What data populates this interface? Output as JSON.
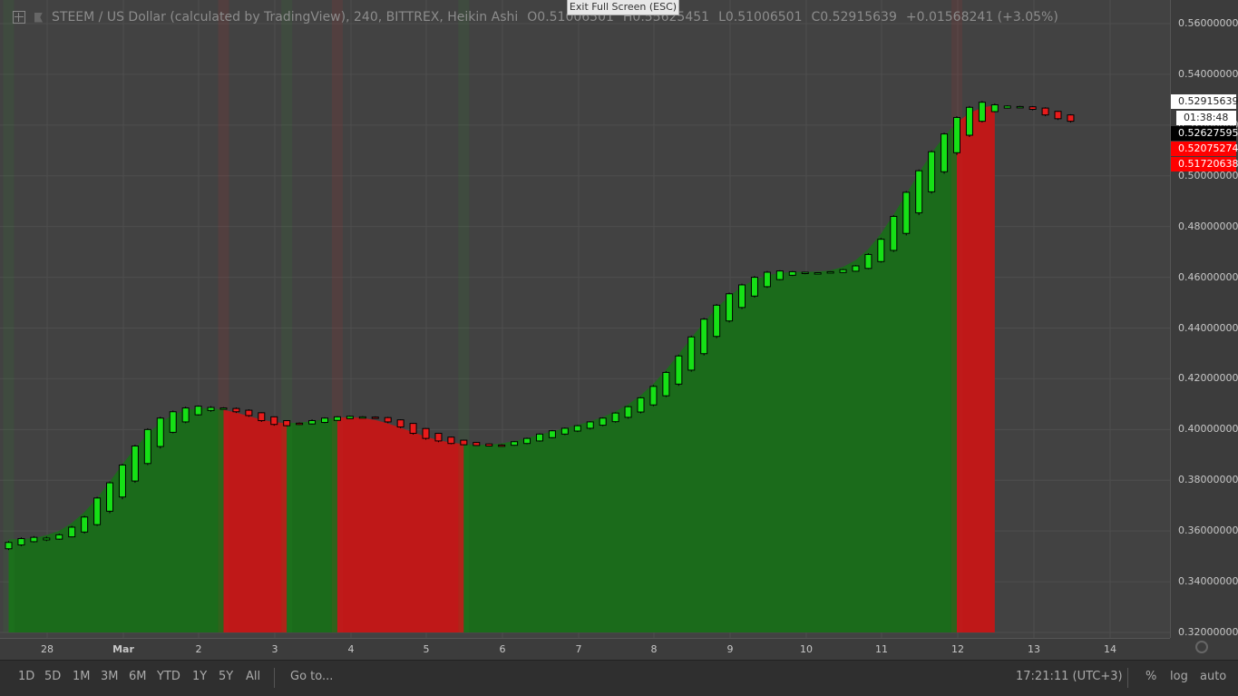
{
  "legend": {
    "title": "STEEM / US Dollar (calculated by TradingView), 240, BITTREX, Heikin Ashi",
    "open": "O0.51006501",
    "high": "H0.55625451",
    "low": "L0.51006501",
    "close": "C0.52915639",
    "change": "+0.01568241 (+3.05%)"
  },
  "exit_fullscreen": "Exit Full Screen (ESC)",
  "price_labels": {
    "last": "0.52915639",
    "countdown": "01:38:48",
    "dark": "0.52627595",
    "red1": "0.52075274",
    "red2": "0.51720638"
  },
  "colors": {
    "up": "#16e016",
    "down": "#e81b1b",
    "area_up": "#1b6b1b",
    "area_down": "#bf1818",
    "background": "#424242"
  },
  "chart_data": {
    "type": "candlestick",
    "chart_style": "Heikin Ashi",
    "interval": "240",
    "exchange": "BITTREX",
    "symbol": "STEEM / US Dollar",
    "ylim": [
      0.32,
      0.565
    ],
    "y_ticks": [
      "0.56000000",
      "0.54000000",
      "0.52000000",
      "0.50000000",
      "0.48000000",
      "0.46000000",
      "0.44000000",
      "0.42000000",
      "0.40000000",
      "0.38000000",
      "0.36000000",
      "0.34000000",
      "0.32000000"
    ],
    "x_ticks": [
      "28",
      "Mar",
      "2",
      "3",
      "4",
      "5",
      "6",
      "7",
      "8",
      "9",
      "10",
      "11",
      "12",
      "13",
      "14"
    ],
    "candles": [
      {
        "open": 0.353,
        "close": 0.3555,
        "high": 0.356,
        "low": 0.3525
      },
      {
        "open": 0.3545,
        "close": 0.357,
        "high": 0.3575,
        "low": 0.354
      },
      {
        "open": 0.3558,
        "close": 0.3575,
        "high": 0.358,
        "low": 0.3555
      },
      {
        "open": 0.3565,
        "close": 0.3572,
        "high": 0.3578,
        "low": 0.356
      },
      {
        "open": 0.3568,
        "close": 0.3585,
        "high": 0.359,
        "low": 0.3565
      },
      {
        "open": 0.3577,
        "close": 0.3615,
        "high": 0.362,
        "low": 0.3575
      },
      {
        "open": 0.3596,
        "close": 0.3655,
        "high": 0.366,
        "low": 0.359
      },
      {
        "open": 0.3625,
        "close": 0.373,
        "high": 0.3735,
        "low": 0.362
      },
      {
        "open": 0.3678,
        "close": 0.379,
        "high": 0.3795,
        "low": 0.367
      },
      {
        "open": 0.3734,
        "close": 0.386,
        "high": 0.3865,
        "low": 0.3725
      },
      {
        "open": 0.3797,
        "close": 0.3935,
        "high": 0.394,
        "low": 0.379
      },
      {
        "open": 0.3866,
        "close": 0.4,
        "high": 0.4005,
        "low": 0.386
      },
      {
        "open": 0.3933,
        "close": 0.4045,
        "high": 0.405,
        "low": 0.3925
      },
      {
        "open": 0.3989,
        "close": 0.407,
        "high": 0.4075,
        "low": 0.3985
      },
      {
        "open": 0.403,
        "close": 0.4085,
        "high": 0.409,
        "low": 0.4025
      },
      {
        "open": 0.4058,
        "close": 0.4092,
        "high": 0.4095,
        "low": 0.4055
      },
      {
        "open": 0.4075,
        "close": 0.4087,
        "high": 0.4092,
        "low": 0.407
      },
      {
        "open": 0.4081,
        "close": 0.4085,
        "high": 0.4088,
        "low": 0.4078
      },
      {
        "open": 0.4083,
        "close": 0.407,
        "high": 0.4087,
        "low": 0.4065
      },
      {
        "open": 0.4076,
        "close": 0.4055,
        "high": 0.408,
        "low": 0.405
      },
      {
        "open": 0.4066,
        "close": 0.4035,
        "high": 0.4068,
        "low": 0.403
      },
      {
        "open": 0.405,
        "close": 0.402,
        "high": 0.4052,
        "low": 0.4015
      },
      {
        "open": 0.4035,
        "close": 0.4015,
        "high": 0.4037,
        "low": 0.4012
      },
      {
        "open": 0.4025,
        "close": 0.402,
        "high": 0.4028,
        "low": 0.4018
      },
      {
        "open": 0.4022,
        "close": 0.4035,
        "high": 0.404,
        "low": 0.402
      },
      {
        "open": 0.4028,
        "close": 0.4045,
        "high": 0.4048,
        "low": 0.4025
      },
      {
        "open": 0.4036,
        "close": 0.405,
        "high": 0.4053,
        "low": 0.4034
      },
      {
        "open": 0.4043,
        "close": 0.4052,
        "high": 0.4055,
        "low": 0.4041
      },
      {
        "open": 0.4048,
        "close": 0.405,
        "high": 0.4053,
        "low": 0.4046
      },
      {
        "open": 0.4049,
        "close": 0.4045,
        "high": 0.4052,
        "low": 0.4044
      },
      {
        "open": 0.4047,
        "close": 0.403,
        "high": 0.405,
        "low": 0.4025
      },
      {
        "open": 0.4038,
        "close": 0.401,
        "high": 0.404,
        "low": 0.4005
      },
      {
        "open": 0.4024,
        "close": 0.3985,
        "high": 0.4026,
        "low": 0.398
      },
      {
        "open": 0.4004,
        "close": 0.3965,
        "high": 0.4006,
        "low": 0.396
      },
      {
        "open": 0.3985,
        "close": 0.3955,
        "high": 0.3987,
        "low": 0.395
      },
      {
        "open": 0.397,
        "close": 0.3945,
        "high": 0.3972,
        "low": 0.3942
      },
      {
        "open": 0.3958,
        "close": 0.394,
        "high": 0.396,
        "low": 0.3938
      },
      {
        "open": 0.3949,
        "close": 0.3937,
        "high": 0.3951,
        "low": 0.3935
      },
      {
        "open": 0.3943,
        "close": 0.3935,
        "high": 0.3945,
        "low": 0.3933
      },
      {
        "open": 0.3939,
        "close": 0.3937,
        "high": 0.3942,
        "low": 0.3935
      },
      {
        "open": 0.3938,
        "close": 0.3952,
        "high": 0.3955,
        "low": 0.3936
      },
      {
        "open": 0.3945,
        "close": 0.3965,
        "high": 0.3968,
        "low": 0.3942
      },
      {
        "open": 0.3955,
        "close": 0.3982,
        "high": 0.3985,
        "low": 0.3952
      },
      {
        "open": 0.3968,
        "close": 0.3995,
        "high": 0.3998,
        "low": 0.3965
      },
      {
        "open": 0.3982,
        "close": 0.4005,
        "high": 0.4008,
        "low": 0.3978
      },
      {
        "open": 0.3994,
        "close": 0.4015,
        "high": 0.4018,
        "low": 0.399
      },
      {
        "open": 0.4005,
        "close": 0.403,
        "high": 0.4033,
        "low": 0.4
      },
      {
        "open": 0.4017,
        "close": 0.4045,
        "high": 0.4048,
        "low": 0.4013
      },
      {
        "open": 0.4031,
        "close": 0.4065,
        "high": 0.4068,
        "low": 0.4027
      },
      {
        "open": 0.4048,
        "close": 0.409,
        "high": 0.4093,
        "low": 0.4043
      },
      {
        "open": 0.4069,
        "close": 0.4125,
        "high": 0.4128,
        "low": 0.4064
      },
      {
        "open": 0.4097,
        "close": 0.417,
        "high": 0.4175,
        "low": 0.4092
      },
      {
        "open": 0.4133,
        "close": 0.4225,
        "high": 0.423,
        "low": 0.4128
      },
      {
        "open": 0.4179,
        "close": 0.429,
        "high": 0.4295,
        "low": 0.4172
      },
      {
        "open": 0.4234,
        "close": 0.4365,
        "high": 0.437,
        "low": 0.4228
      },
      {
        "open": 0.4299,
        "close": 0.4435,
        "high": 0.444,
        "low": 0.4292
      },
      {
        "open": 0.4367,
        "close": 0.449,
        "high": 0.4495,
        "low": 0.436
      },
      {
        "open": 0.4428,
        "close": 0.4535,
        "high": 0.454,
        "low": 0.4422
      },
      {
        "open": 0.4481,
        "close": 0.457,
        "high": 0.4575,
        "low": 0.4475
      },
      {
        "open": 0.4526,
        "close": 0.46,
        "high": 0.4605,
        "low": 0.452
      },
      {
        "open": 0.4563,
        "close": 0.462,
        "high": 0.4625,
        "low": 0.4558
      },
      {
        "open": 0.4591,
        "close": 0.4625,
        "high": 0.4628,
        "low": 0.4588
      },
      {
        "open": 0.4608,
        "close": 0.4622,
        "high": 0.4625,
        "low": 0.4605
      },
      {
        "open": 0.4615,
        "close": 0.462,
        "high": 0.4622,
        "low": 0.4612
      },
      {
        "open": 0.4617,
        "close": 0.4618,
        "high": 0.462,
        "low": 0.4615
      },
      {
        "open": 0.4617,
        "close": 0.4622,
        "high": 0.4624,
        "low": 0.4615
      },
      {
        "open": 0.4619,
        "close": 0.463,
        "high": 0.4633,
        "low": 0.4617
      },
      {
        "open": 0.4624,
        "close": 0.4645,
        "high": 0.4648,
        "low": 0.4622
      },
      {
        "open": 0.4635,
        "close": 0.469,
        "high": 0.4695,
        "low": 0.4632
      },
      {
        "open": 0.4662,
        "close": 0.475,
        "high": 0.4755,
        "low": 0.4658
      },
      {
        "open": 0.4706,
        "close": 0.484,
        "high": 0.4845,
        "low": 0.47
      },
      {
        "open": 0.4773,
        "close": 0.4935,
        "high": 0.494,
        "low": 0.4765
      },
      {
        "open": 0.4854,
        "close": 0.502,
        "high": 0.5025,
        "low": 0.4845
      },
      {
        "open": 0.4937,
        "close": 0.5095,
        "high": 0.51,
        "low": 0.493
      },
      {
        "open": 0.5016,
        "close": 0.5165,
        "high": 0.517,
        "low": 0.5008
      },
      {
        "open": 0.5091,
        "close": 0.523,
        "high": 0.5235,
        "low": 0.5082
      },
      {
        "open": 0.516,
        "close": 0.527,
        "high": 0.5275,
        "low": 0.5153
      },
      {
        "open": 0.5215,
        "close": 0.529,
        "high": 0.5295,
        "low": 0.521
      },
      {
        "open": 0.5253,
        "close": 0.528,
        "high": 0.5285,
        "low": 0.525
      },
      {
        "open": 0.5267,
        "close": 0.5275,
        "high": 0.5278,
        "low": 0.5265
      },
      {
        "open": 0.5271,
        "close": 0.5273,
        "high": 0.5276,
        "low": 0.5269
      },
      {
        "open": 0.5272,
        "close": 0.5262,
        "high": 0.5275,
        "low": 0.5258
      },
      {
        "open": 0.5267,
        "close": 0.524,
        "high": 0.527,
        "low": 0.5235
      },
      {
        "open": 0.5254,
        "close": 0.5225,
        "high": 0.5256,
        "low": 0.522
      },
      {
        "open": 0.524,
        "close": 0.5215,
        "high": 0.5243,
        "low": 0.521
      }
    ],
    "area_segments": [
      {
        "from": 0,
        "to": 17,
        "direction": "up"
      },
      {
        "from": 17,
        "to": 22,
        "direction": "down"
      },
      {
        "from": 22,
        "to": 26,
        "direction": "up"
      },
      {
        "from": 26,
        "to": 36,
        "direction": "down"
      },
      {
        "from": 36,
        "to": 75,
        "direction": "up"
      },
      {
        "from": 75,
        "to": 78,
        "direction": "down"
      }
    ]
  },
  "toolbar": {
    "ranges": [
      "1D",
      "5D",
      "1M",
      "3M",
      "6M",
      "YTD",
      "1Y",
      "5Y",
      "All"
    ],
    "goto": "Go to...",
    "clock": "17:21:11 (UTC+3)",
    "percent": "%",
    "log": "log",
    "auto": "auto"
  }
}
